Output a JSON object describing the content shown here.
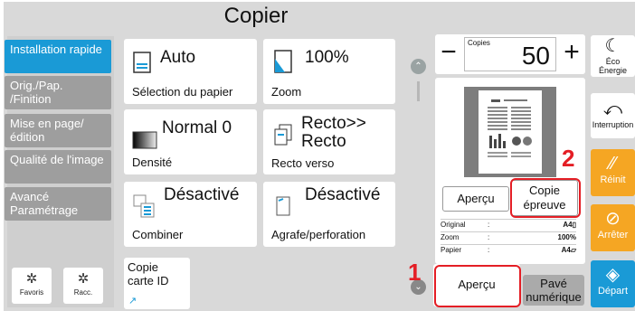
{
  "header": {
    "title": "Copier"
  },
  "sidebar": {
    "items": [
      {
        "label": "Installation rapide",
        "active": true
      },
      {
        "label": "Orig./Pap. /Finition",
        "active": false
      },
      {
        "label": "Mise en page/édition",
        "active": false
      },
      {
        "label": "Qualité de l'image",
        "active": false
      },
      {
        "label": "Avancé Paramétrage",
        "active": false
      }
    ],
    "favorites_label": "Favoris",
    "shortcut_label": "Racc."
  },
  "tiles": {
    "paper": {
      "value": "Auto",
      "label": "Sélection du papier"
    },
    "zoom": {
      "value": "100%",
      "label": "Zoom"
    },
    "density": {
      "value": "Normal 0",
      "label": "Densité"
    },
    "duplex": {
      "value": "Recto>> Recto",
      "label": "Recto verso"
    },
    "combine": {
      "value": "Désactivé",
      "label": "Combiner"
    },
    "staple": {
      "value": "Désactivé",
      "label": "Agrafe/perforation"
    },
    "id_card": {
      "label": "Copie carte ID"
    }
  },
  "copies": {
    "label": "Copies",
    "value": "50",
    "minus": "−",
    "plus": "+"
  },
  "preview": {
    "preview_button": "Aperçu",
    "proof_copy_button": "Copie épreuve",
    "info": [
      {
        "key": "Original",
        "sep": ":",
        "value": "A4▯"
      },
      {
        "key": "Zoom",
        "sep": ":",
        "value": "100%"
      },
      {
        "key": "Papier",
        "sep": ":",
        "value": "A4▱"
      }
    ]
  },
  "bottom": {
    "preview_button": "Aperçu",
    "keypad_button": "Pavé numérique"
  },
  "right_column": {
    "eco": "Éco Énergie",
    "interrupt": "Interruption",
    "reset": "Réinit",
    "stop": "Arrêter",
    "start": "Départ"
  },
  "callouts": {
    "one": "1",
    "two": "2"
  },
  "colors": {
    "accent_blue": "#1a9ad6",
    "orange": "#f5a623",
    "callout_red": "#e41e25",
    "sidebar_gray": "#9e9e9e"
  }
}
